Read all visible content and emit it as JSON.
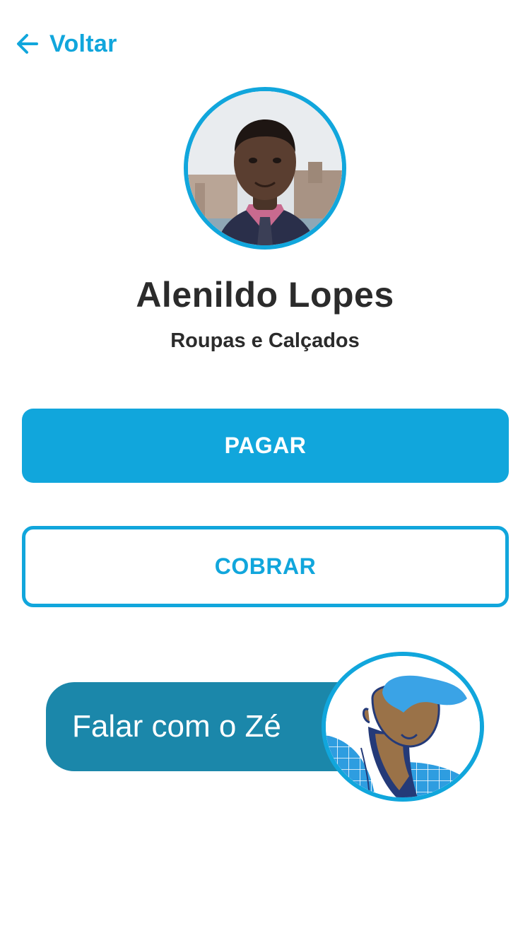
{
  "nav": {
    "back_label": "Voltar",
    "back_icon": "arrow-left-icon"
  },
  "profile": {
    "name": "Alenildo Lopes",
    "category": "Roupas e Calçados",
    "avatar_icon": "profile-photo"
  },
  "actions": {
    "pay_label": "PAGAR",
    "charge_label": "COBRAR"
  },
  "assistant": {
    "chat_label": "Falar com o Zé",
    "avatar_icon": "assistant-avatar-illustration"
  },
  "colors": {
    "accent": "#11a6dc",
    "chat_bubble": "#1b87aa",
    "text_dark": "#2b2b2b",
    "background": "#ffffff"
  }
}
